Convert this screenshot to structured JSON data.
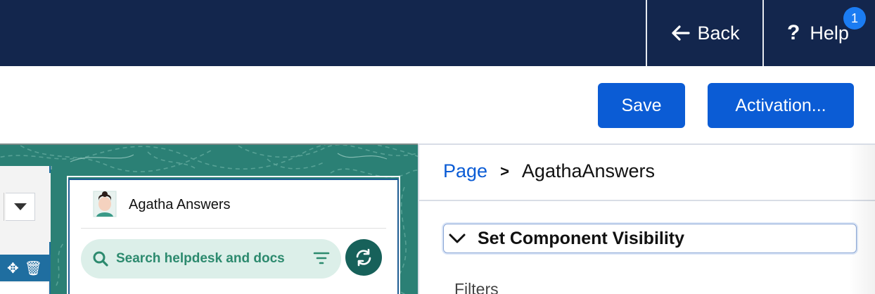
{
  "topbar": {
    "back_label": "Back",
    "help_label": "Help",
    "help_badge": "1"
  },
  "toolbar": {
    "save_label": "Save",
    "activation_label": "Activation..."
  },
  "widget": {
    "title": "Agatha Answers",
    "search_placeholder": "Search helpdesk and docs"
  },
  "panel": {
    "breadcrumb_root": "Page",
    "breadcrumb_separator": ">",
    "breadcrumb_current": "AgathaAnswers",
    "section_title": "Set Component Visibility",
    "filters_label": "Filters"
  },
  "colors": {
    "topbar": "#13264d",
    "primary": "#0b5cd5",
    "canvas": "#2b8075",
    "search_pill": "#dcefe9",
    "refresh": "#17615a"
  },
  "icons": [
    "arrow-left-icon",
    "question-icon",
    "move-icon",
    "trash-icon",
    "search-icon",
    "filter-icon",
    "refresh-icon",
    "chevron-down-icon",
    "avatar"
  ]
}
